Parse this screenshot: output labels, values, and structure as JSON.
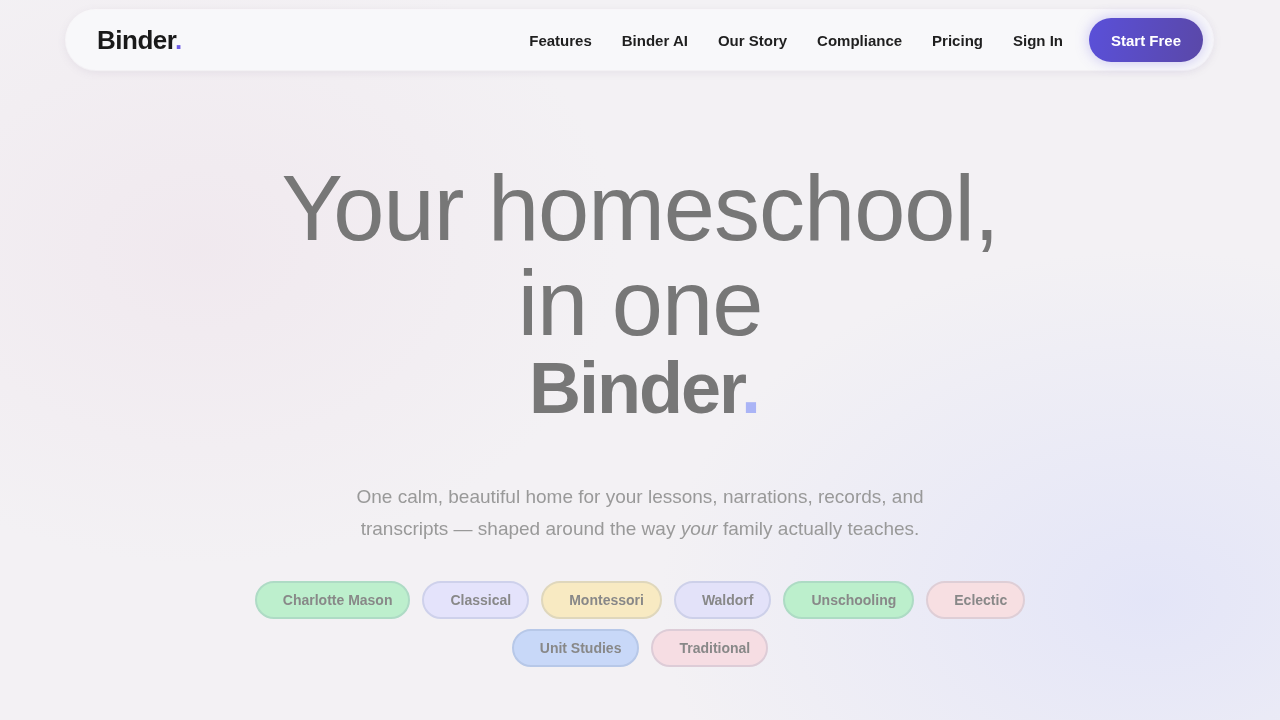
{
  "nav": {
    "logo": {
      "text": "Binder",
      "dot": "."
    },
    "links": [
      "Features",
      "Binder AI",
      "Our Story",
      "Compliance",
      "Pricing",
      "Sign In"
    ],
    "cta": "Start Free"
  },
  "hero": {
    "headline_lines": [
      "Your homeschool,",
      "in one"
    ],
    "wordmark": {
      "text": "Binder",
      "dot": "."
    },
    "subtitle": "One calm, beautiful home for your lessons, narrations, records, and transcripts — shaped around the way *your* family actually teaches.",
    "tags": [
      {
        "label": "Charlotte Mason",
        "color": "#bdefcd"
      },
      {
        "label": "Classical",
        "color": "#e4e3fb"
      },
      {
        "label": "Montessori",
        "color": "#f8eac2"
      },
      {
        "label": "Waldorf",
        "color": "#e3e2f9"
      },
      {
        "label": "Unschooling",
        "color": "#bcefcc"
      },
      {
        "label": "Eclectic",
        "color": "#f7dfe2"
      },
      {
        "label": "Unit Studies",
        "color": "#c8d8f8"
      },
      {
        "label": "Traditional",
        "color": "#f6dde3"
      }
    ]
  }
}
